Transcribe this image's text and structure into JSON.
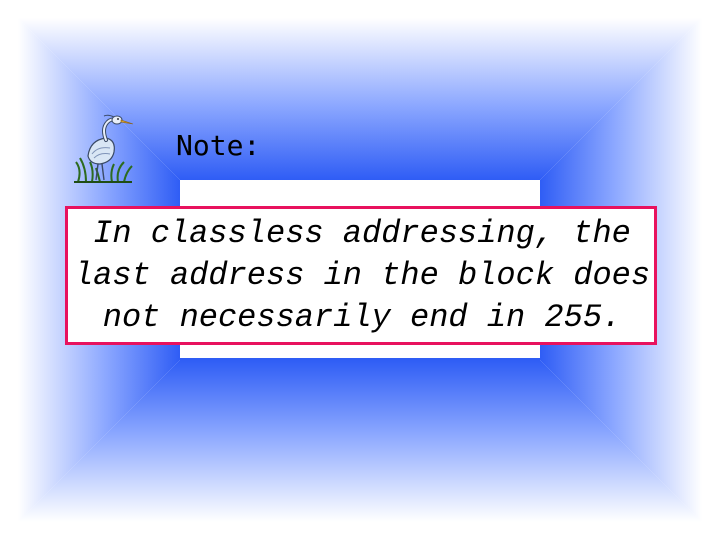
{
  "slide": {
    "note_label": "Note:",
    "note_text": "In classless addressing, the last address in the block does not necessarily end in 255.",
    "colors": {
      "center_blue": "#2f5df5",
      "edge_white": "#ffffff",
      "box_border": "#e8125e",
      "text": "#000000"
    },
    "icons": {
      "bird": "heron-icon"
    }
  }
}
